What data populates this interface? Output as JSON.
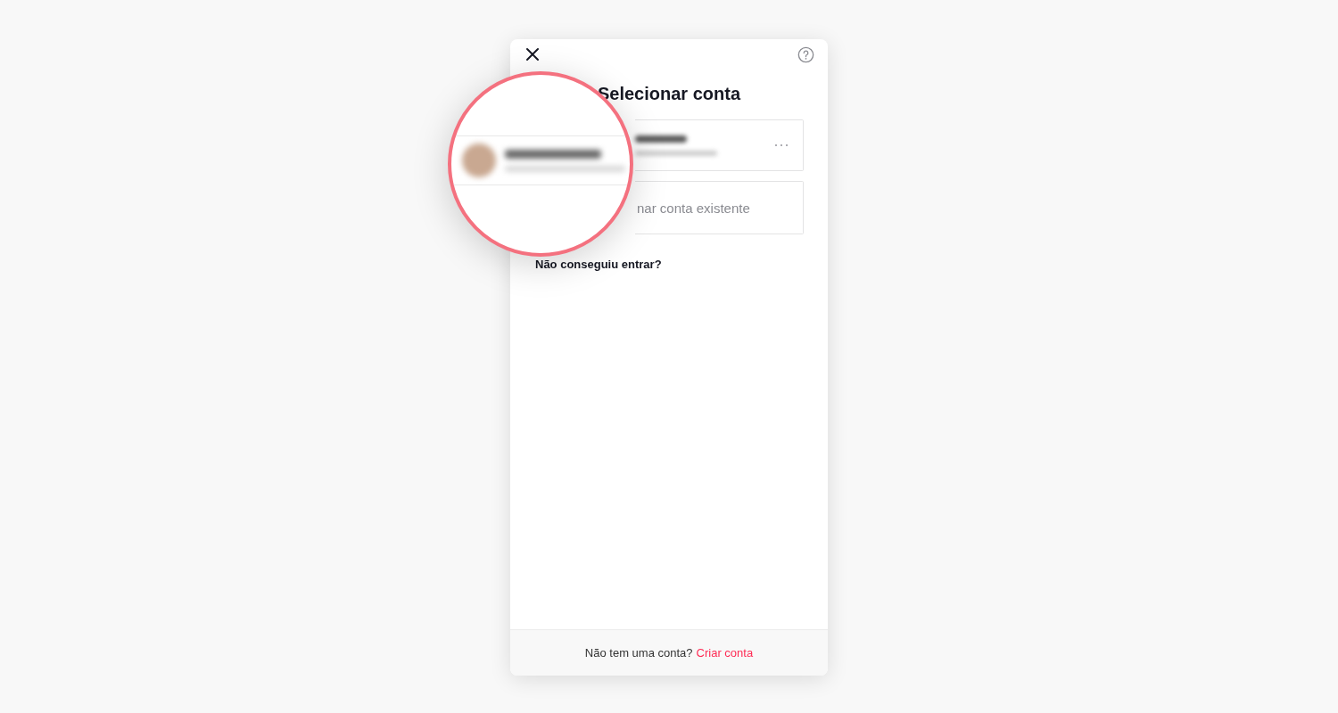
{
  "dialog": {
    "title": "Selecionar conta"
  },
  "accounts": [
    {
      "kind": "blurred"
    }
  ],
  "add_account": {
    "label": "nar conta existente"
  },
  "help_link": "Não conseguiu entrar?",
  "footer": {
    "text": "Não tem uma conta?",
    "link": "Criar conta"
  },
  "magnifier": {
    "kind": "blurred-account"
  }
}
